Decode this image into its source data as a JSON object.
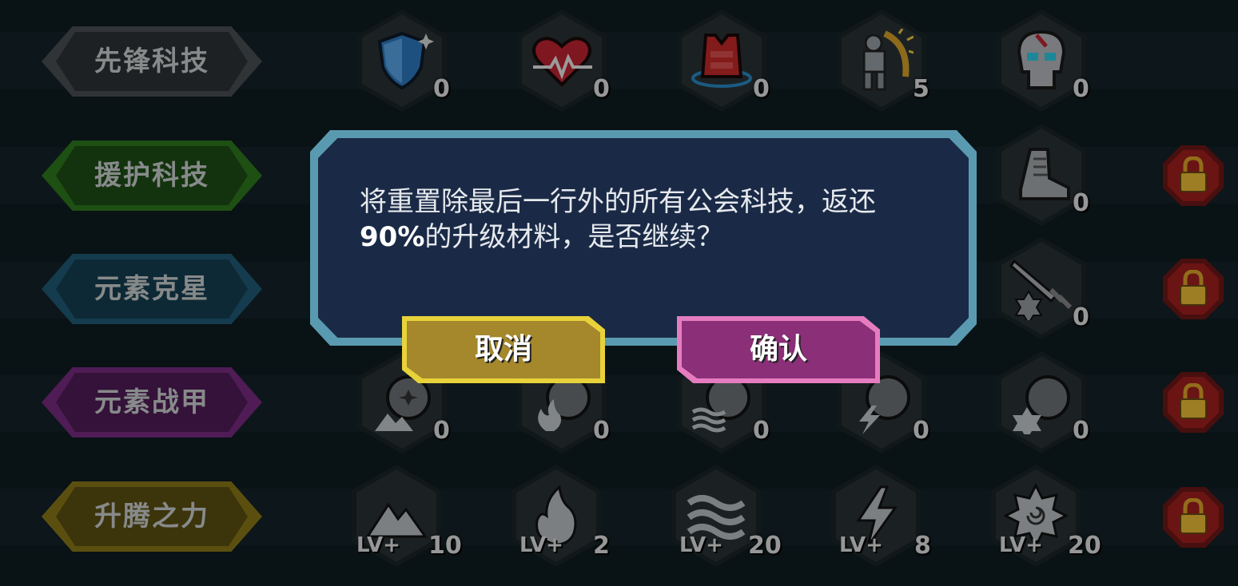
{
  "categories": [
    {
      "label": "先锋科技",
      "color": "#4a5154",
      "inner": "#2e3436"
    },
    {
      "label": "援护科技",
      "color": "#2f7a1e",
      "inner": "#1d4f14"
    },
    {
      "label": "元素克星",
      "color": "#1f5d78",
      "inner": "#143f52"
    },
    {
      "label": "元素战甲",
      "color": "#7a2c83",
      "inner": "#511c58"
    },
    {
      "label": "升腾之力",
      "color": "#8c7a1a",
      "inner": "#5d5011"
    }
  ],
  "rows": {
    "row1": {
      "counts": [
        "0",
        "0",
        "0",
        "5",
        "0"
      ],
      "icons": [
        "shield-icon",
        "heart-icon",
        "armor-vest-icon",
        "knight-icon",
        "skull-icon"
      ]
    },
    "row2": {
      "counts": [
        "0"
      ],
      "icons": [
        "boot-icon"
      ]
    },
    "row3": {
      "counts": [
        "0"
      ],
      "icons": [
        "sword-icon"
      ]
    },
    "row4": {
      "counts": [
        "0",
        "0",
        "0",
        "0",
        "0"
      ],
      "icons": [
        "earth-shield-icon",
        "fire-shield-icon",
        "water-shield-icon",
        "lightning-shield-icon",
        "wind-shield-icon"
      ]
    },
    "row5": {
      "lv_prefix": "LV+",
      "counts": [
        "10",
        "2",
        "20",
        "8",
        "20"
      ],
      "icons": [
        "mountain-icon",
        "flame-icon",
        "waves-icon",
        "lightning-icon",
        "swirl-icon"
      ]
    }
  },
  "locks": [
    "lock-icon",
    "lock-icon",
    "lock-icon",
    "lock-icon"
  ],
  "dialog": {
    "message_part1": "将重置除最后一行外的所有公会科技，返还",
    "message_percent": "90%",
    "message_part2": "的升级材料，是否继续？",
    "cancel_label": "取消",
    "confirm_label": "确认"
  },
  "colors": {
    "cancel": "#a5872c",
    "cancel_border": "#e8d23a",
    "confirm": "#8a2f78",
    "confirm_border": "#e67cc0",
    "dialog_border": "#5a9ab0",
    "dialog_bg": "#1a2a46",
    "lock": "#a32020"
  }
}
